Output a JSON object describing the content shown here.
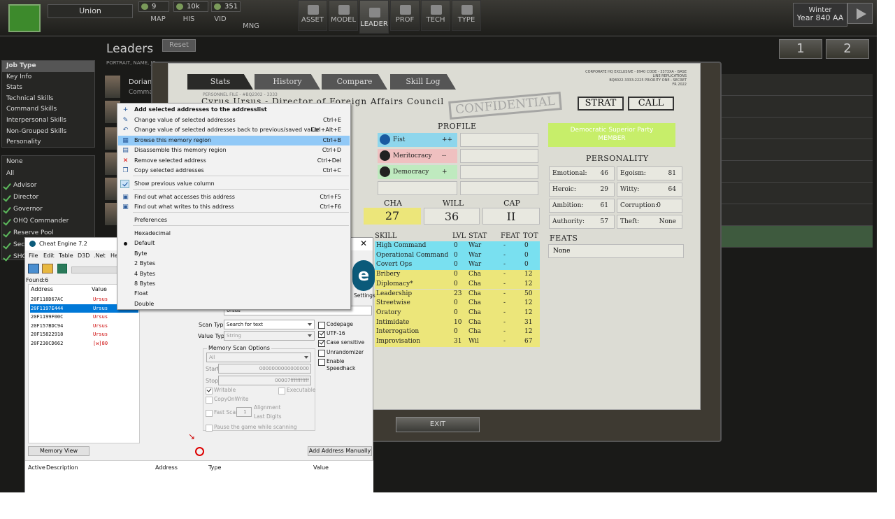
{
  "topbar": {
    "nation": "Union",
    "resources": [
      "9",
      "10k",
      "351"
    ],
    "nav_small": [
      "MAP",
      "HIS",
      "VID",
      "MNG"
    ],
    "nav_big": [
      "ASSET",
      "MODEL",
      "LEADER",
      "PROF",
      "TECH",
      "TYPE"
    ],
    "season": "Winter",
    "year": "Year 840 AA",
    "pages": [
      "1",
      "2"
    ]
  },
  "sidebar": {
    "leaders_title": "Leaders",
    "reset": "Reset",
    "portrait_header": "PORTRAIT, NAME, JC",
    "first_name": "Dorian",
    "first_role": "Comma",
    "filters": [
      "Job Type",
      "Key Info",
      "Stats",
      "Technical Skills",
      "Command Skills",
      "Interpersonal Skills",
      "Non-Grouped Skills",
      "Personality"
    ],
    "jobs_plain": [
      "None",
      "All"
    ],
    "jobs_checked": [
      "Advisor",
      "Director",
      "Governor",
      "OHQ Commander",
      "Reserve Pool",
      "Secr",
      "SHQ"
    ]
  },
  "dossier": {
    "tabs": [
      "Stats",
      "History",
      "Compare",
      "Skill Log"
    ],
    "smallprint": "CORPORATE HQ EXCLUSIVE - 8940 CODE - 3373XA - BASE LINE REPLICATIONS\nBQ8022-3333-2225 PRIORITY ONE - SECRET\nFR 2022",
    "personnel_file": "PERSONNEL FILE - #BQ2302 - 3333",
    "name_title": "Cyrus Ursus - Director of Foreign Affairs Council",
    "stamp": "CONFIDENTIAL",
    "strat": "STRAT",
    "call": "CALL",
    "profile_title": "PROFILE",
    "profile": [
      {
        "icon": "fist-icon",
        "label": "Fist",
        "value": "++",
        "color": "#8ed6ec"
      },
      {
        "icon": "meritocracy-icon",
        "label": "Meritocracy",
        "value": "--",
        "color": "#efc0c0"
      },
      {
        "icon": "democracy-star-icon",
        "label": "Democracy",
        "value": "+",
        "color": "#bfeabf"
      }
    ],
    "party": "Democratic Superior Party",
    "party_role": "MEMBER",
    "party_color": "#c7ee6a",
    "personality_title": "PERSONALITY",
    "personality": [
      {
        "label": "Emotional:",
        "value": "46"
      },
      {
        "label": "Egoism:",
        "value": "81"
      },
      {
        "label": "Heroic:",
        "value": "29"
      },
      {
        "label": "Witty:",
        "value": "64"
      },
      {
        "label": "Ambition:",
        "value": "61"
      },
      {
        "label": "Corruption:",
        "value": "0"
      },
      {
        "label": "Authority:",
        "value": "57"
      },
      {
        "label": "Theft:",
        "value": "None"
      }
    ],
    "stats": [
      {
        "label": "CHA",
        "value": "27"
      },
      {
        "label": "WILL",
        "value": "36"
      },
      {
        "label": "CAP",
        "value": "II"
      }
    ],
    "skill_headers": [
      "SKILL",
      "LVL",
      "STAT",
      "FEAT",
      "TOT"
    ],
    "skills": [
      {
        "name": "High Command",
        "lvl": "0",
        "stat": "War",
        "feat": "-",
        "tot": "0",
        "color": "#79e0f0"
      },
      {
        "name": "Operational Command",
        "lvl": "0",
        "stat": "War",
        "feat": "-",
        "tot": "0",
        "color": "#79e0f0"
      },
      {
        "name": "Covert Ops",
        "lvl": "0",
        "stat": "War",
        "feat": "-",
        "tot": "0",
        "color": "#79e0f0"
      },
      {
        "name": "Bribery",
        "lvl": "0",
        "stat": "Cha",
        "feat": "-",
        "tot": "12",
        "color": "#ece67a"
      },
      {
        "name": "Diplomacy*",
        "lvl": "0",
        "stat": "Cha",
        "feat": "-",
        "tot": "12",
        "color": "#ece67a"
      },
      {
        "name": "Leadership",
        "lvl": "23",
        "stat": "Cha",
        "feat": "-",
        "tot": "50",
        "color": "#ece67a"
      },
      {
        "name": "Streetwise",
        "lvl": "0",
        "stat": "Cha",
        "feat": "-",
        "tot": "12",
        "color": "#ece67a"
      },
      {
        "name": "Oratory",
        "lvl": "0",
        "stat": "Cha",
        "feat": "-",
        "tot": "12",
        "color": "#ece67a"
      },
      {
        "name": "Intimidate",
        "lvl": "10",
        "stat": "Cha",
        "feat": "-",
        "tot": "31",
        "color": "#ece67a"
      },
      {
        "name": "Interrogation",
        "lvl": "0",
        "stat": "Cha",
        "feat": "-",
        "tot": "12",
        "color": "#ece67a"
      },
      {
        "name": "Improvisation",
        "lvl": "31",
        "stat": "Wil",
        "feat": "-",
        "tot": "67",
        "color": "#ece67a"
      }
    ],
    "feats_title": "FEATS",
    "feats": "None",
    "exit": "EXIT"
  },
  "cheat_engine": {
    "title": "Cheat Engine 7.2",
    "menu": [
      "File",
      "Edit",
      "Table",
      "D3D",
      ".Net",
      "He"
    ],
    "found": "Found:6",
    "col_address": "Address",
    "col_value": "Value",
    "results": [
      {
        "address": "20F118D67AC",
        "value": "Ursus"
      },
      {
        "address": "20F1197E444",
        "value": "Ursus"
      },
      {
        "address": "20F1199F00C",
        "value": "Ursus"
      },
      {
        "address": "20F157BDC94",
        "value": "Ursus"
      },
      {
        "address": "20F15822918",
        "value": "Ursus"
      },
      {
        "address": "20F230CD662",
        "value": "[w]80"
      }
    ],
    "settings": "Settings",
    "search_value": "Ursus",
    "scan_type_label": "Scan Type",
    "scan_type": "Search for text",
    "value_type_label": "Value Type",
    "value_type": "String",
    "options": {
      "codepage": "Codepage",
      "utf16": "UTF-16",
      "case": "Case sensitive",
      "unrandomizer": "Unrandomizer",
      "speedhack": "Enable Speedhack"
    },
    "mem_scan_title": "Memory Scan Options",
    "mem_region": "All",
    "start_label": "Start",
    "start": "0000000000000000",
    "stop_label": "Stop",
    "stop": "00007fffffffffff",
    "writable": "Writable",
    "executable": "Executable",
    "copyonwrite": "CopyOnWrite",
    "fast_scan": "Fast Scan",
    "fast_scan_value": "1",
    "alignment": "Alignment",
    "last_digits": "Last Digits",
    "pause": "Pause the game while scanning",
    "memory_view": "Memory View",
    "add_manual": "Add Address Manually",
    "table_headers": [
      "Active",
      "Description",
      "Address",
      "Type",
      "Value"
    ]
  },
  "context_menu": {
    "items": [
      {
        "label": "Add selected addresses to the addresslist",
        "key": "",
        "icon": "add-icon"
      },
      {
        "label": "Change value of selected addresses",
        "key": "Ctrl+E",
        "icon": "edit-icon"
      },
      {
        "label": "Change value of selected addresses back to previous/saved value",
        "key": "Ctrl+Alt+E",
        "icon": "undo-icon"
      },
      {
        "label": "Browse this memory region",
        "key": "Ctrl+B",
        "icon": "browse-icon"
      },
      {
        "label": "Disassemble this memory region",
        "key": "Ctrl+D",
        "icon": "disassemble-icon"
      },
      {
        "label": "Remove selected address",
        "key": "Ctrl+Del",
        "icon": "remove-icon"
      },
      {
        "label": "Copy selected addresses",
        "key": "Ctrl+C",
        "icon": "copy-icon"
      },
      {
        "label": "Show previous value column",
        "key": "",
        "icon": "check-icon"
      },
      {
        "label": "Find out what accesses this address",
        "key": "Ctrl+F5",
        "icon": "find-access-icon"
      },
      {
        "label": "Find out what writes to this address",
        "key": "Ctrl+F6",
        "icon": "find-write-icon"
      },
      {
        "label": "Preferences",
        "key": "",
        "icon": ""
      },
      {
        "label": "Hexadecimal",
        "key": "",
        "icon": ""
      },
      {
        "label": "Default",
        "key": "",
        "icon": "radio-icon"
      },
      {
        "label": "Byte",
        "key": "",
        "icon": ""
      },
      {
        "label": "2 Bytes",
        "key": "",
        "icon": ""
      },
      {
        "label": "4 Bytes",
        "key": "",
        "icon": ""
      },
      {
        "label": "8 Bytes",
        "key": "",
        "icon": ""
      },
      {
        "label": "Float",
        "key": "",
        "icon": ""
      },
      {
        "label": "Double",
        "key": "",
        "icon": ""
      }
    ]
  }
}
